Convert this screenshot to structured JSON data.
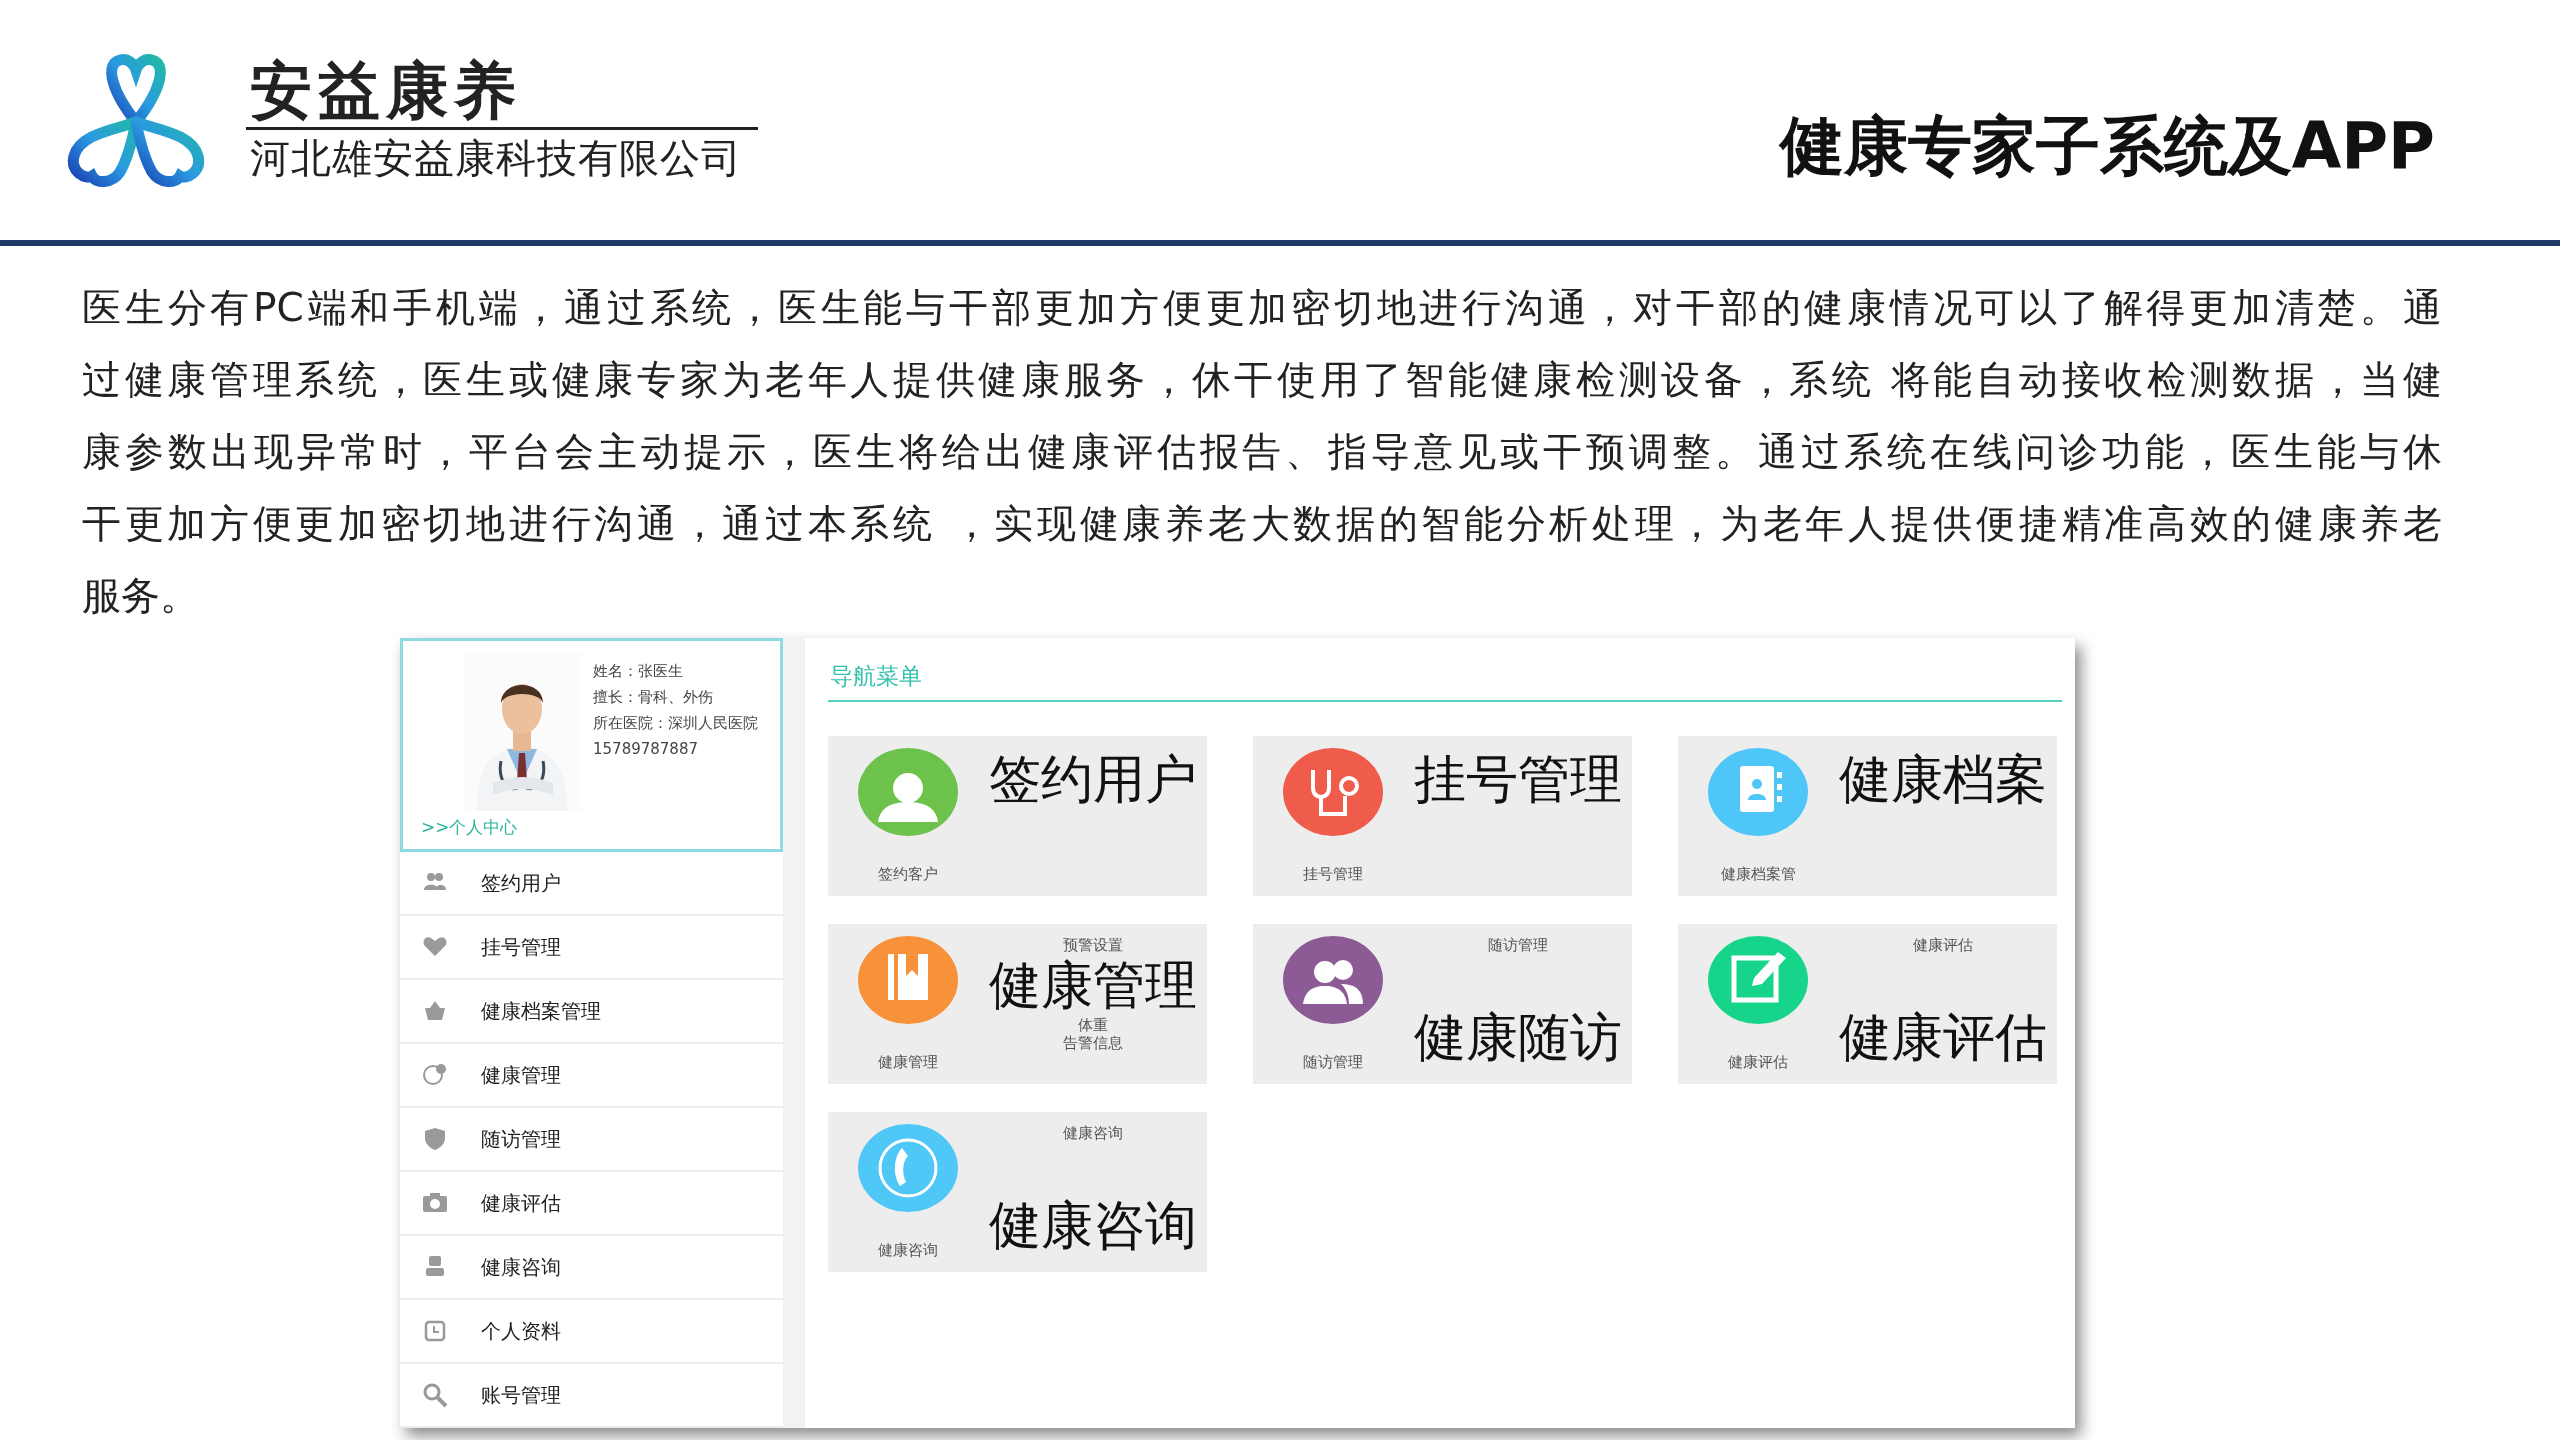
{
  "header": {
    "brand": "安益康养",
    "company": "河北雄安益康科技有限公司",
    "title": "健康专家子系统及APP"
  },
  "intro": {
    "lines": [
      "医生分有PC端和手机端，通过系统，医生能与干部更加方便更加密切地进行沟通，对干部的健康情况可以了解得更加清楚。通",
      "过健康管理系统，医生或健康专家为老年人提供健康服务，休干使用了智能健康检测设备，系统 将能自动接收检测数据，当健",
      "康参数出现异常时，平台会主动提示，医生将给出健康评估报告、指导意见或干预调整。通过系统在线问诊功能，医生能与休",
      "干更加方便更加密切地进行沟通，通过本系统 ，实现健康养老大数据的智能分析处理，为老年人提供便捷精准高效的健康养老",
      "服务。"
    ]
  },
  "app": {
    "profile": {
      "photo": {
        "kind": "picture"
      },
      "lines": [
        "姓名：张医生",
        "擅长：骨科、外伤",
        "所在医院：深圳人民医院",
        "15789787887"
      ],
      "link": ">>个人中心"
    },
    "menu": [
      "签约用户",
      "挂号管理",
      "健康档案管理",
      "健康管理",
      "随访管理",
      "健康评估",
      "健康咨询",
      "个人资料",
      "账号管理"
    ],
    "nav_title": "导航菜单",
    "tiles": [
      {
        "title": "签约用户",
        "caption": "签约客户",
        "color": "#6cc24a"
      },
      {
        "title": "挂号管理",
        "caption": "挂号管理",
        "color": "#f05c4b"
      },
      {
        "title": "健康档案",
        "caption": "健康档案管",
        "color": "#4fc6f8"
      },
      {
        "title": "健康管理",
        "caption": "健康管理",
        "color": "#f7913a",
        "top_note": "预警设置",
        "bottom_notes": [
          "体重",
          "告警信息"
        ]
      },
      {
        "title": "健康随访",
        "caption": "随访管理",
        "color": "#8c5a94",
        "top_note": "随访管理"
      },
      {
        "title": "健康评估",
        "caption": "健康评估",
        "color": "#17d48b",
        "top_note": "健康评估"
      },
      {
        "title": "健康咨询",
        "caption": "健康咨询",
        "color": "#4fc8f7",
        "top_note": "健康咨询"
      }
    ]
  }
}
